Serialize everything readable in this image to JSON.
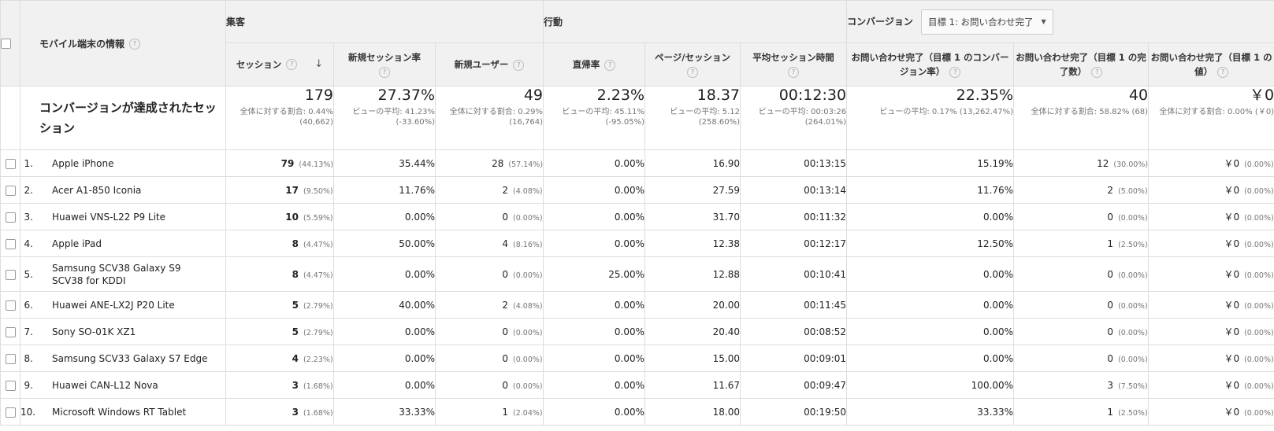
{
  "header": {
    "dimension_label": "モバイル端末の情報",
    "group_acquisition": "集客",
    "group_behavior": "行動",
    "group_conversion": "コンバージョン",
    "goal_select": "目標 1: お問い合わせ完了",
    "columns": {
      "sessions": "セッション",
      "new_session_rate": "新規セッション率",
      "new_users": "新規ユーザー",
      "bounce_rate": "直帰率",
      "pages_per_session": "ページ/セッション",
      "avg_session_duration": "平均セッション時間",
      "goal_cv_rate": "お問い合わせ完了（目標 1 のコンバージョン率）",
      "goal_completions": "お問い合わせ完了（目標 1 の完了数）",
      "goal_value": "お問い合わせ完了（目標 1 の値）"
    },
    "help_glyph": "?",
    "sort_glyph": "↓"
  },
  "totals": {
    "label": "コンバージョンが達成されたセッション",
    "sessions": {
      "value": "179",
      "sub": "全体に対する割合: 0.44% (40,662)"
    },
    "new_session_rate": {
      "value": "27.37%",
      "sub": "ビューの平均: 41.23% (-33.60%)"
    },
    "new_users": {
      "value": "49",
      "sub": "全体に対する割合: 0.29% (16,764)"
    },
    "bounce_rate": {
      "value": "2.23%",
      "sub": "ビューの平均: 45.11% (-95.05%)"
    },
    "pages_per_session": {
      "value": "18.37",
      "sub": "ビューの平均: 5.12 (258.60%)"
    },
    "avg_session_duration": {
      "value": "00:12:30",
      "sub": "ビューの平均: 00:03:26 (264.01%)"
    },
    "goal_cv_rate": {
      "value": "22.35%",
      "sub": "ビューの平均: 0.17% (13,262.47%)"
    },
    "goal_completions": {
      "value": "40",
      "sub": "全体に対する割合: 58.82% (68)"
    },
    "goal_value": {
      "value": "￥0",
      "sub": "全体に対する割合: 0.00% (￥0)"
    }
  },
  "rows": [
    {
      "index": "1.",
      "device": "Apple iPhone",
      "sessions": "79",
      "sessions_pct": "(44.13%)",
      "new_session_rate": "35.44%",
      "new_users": "28",
      "new_users_pct": "(57.14%)",
      "bounce_rate": "0.00%",
      "pages_per_session": "16.90",
      "avg_session_duration": "00:13:15",
      "goal_cv_rate": "15.19%",
      "goal_completions": "12",
      "goal_completions_pct": "(30.00%)",
      "goal_value": "￥0",
      "goal_value_pct": "(0.00%)"
    },
    {
      "index": "2.",
      "device": "Acer A1-850 Iconia",
      "sessions": "17",
      "sessions_pct": "(9.50%)",
      "new_session_rate": "11.76%",
      "new_users": "2",
      "new_users_pct": "(4.08%)",
      "bounce_rate": "0.00%",
      "pages_per_session": "27.59",
      "avg_session_duration": "00:13:14",
      "goal_cv_rate": "11.76%",
      "goal_completions": "2",
      "goal_completions_pct": "(5.00%)",
      "goal_value": "￥0",
      "goal_value_pct": "(0.00%)"
    },
    {
      "index": "3.",
      "device": "Huawei VNS-L22 P9 Lite",
      "sessions": "10",
      "sessions_pct": "(5.59%)",
      "new_session_rate": "0.00%",
      "new_users": "0",
      "new_users_pct": "(0.00%)",
      "bounce_rate": "0.00%",
      "pages_per_session": "31.70",
      "avg_session_duration": "00:11:32",
      "goal_cv_rate": "0.00%",
      "goal_completions": "0",
      "goal_completions_pct": "(0.00%)",
      "goal_value": "￥0",
      "goal_value_pct": "(0.00%)"
    },
    {
      "index": "4.",
      "device": "Apple iPad",
      "sessions": "8",
      "sessions_pct": "(4.47%)",
      "new_session_rate": "50.00%",
      "new_users": "4",
      "new_users_pct": "(8.16%)",
      "bounce_rate": "0.00%",
      "pages_per_session": "12.38",
      "avg_session_duration": "00:12:17",
      "goal_cv_rate": "12.50%",
      "goal_completions": "1",
      "goal_completions_pct": "(2.50%)",
      "goal_value": "￥0",
      "goal_value_pct": "(0.00%)"
    },
    {
      "index": "5.",
      "device": "Samsung SCV38 Galaxy S9 SCV38 for KDDI",
      "sessions": "8",
      "sessions_pct": "(4.47%)",
      "new_session_rate": "0.00%",
      "new_users": "0",
      "new_users_pct": "(0.00%)",
      "bounce_rate": "25.00%",
      "pages_per_session": "12.88",
      "avg_session_duration": "00:10:41",
      "goal_cv_rate": "0.00%",
      "goal_completions": "0",
      "goal_completions_pct": "(0.00%)",
      "goal_value": "￥0",
      "goal_value_pct": "(0.00%)"
    },
    {
      "index": "6.",
      "device": "Huawei ANE-LX2J P20 Lite",
      "sessions": "5",
      "sessions_pct": "(2.79%)",
      "new_session_rate": "40.00%",
      "new_users": "2",
      "new_users_pct": "(4.08%)",
      "bounce_rate": "0.00%",
      "pages_per_session": "20.00",
      "avg_session_duration": "00:11:45",
      "goal_cv_rate": "0.00%",
      "goal_completions": "0",
      "goal_completions_pct": "(0.00%)",
      "goal_value": "￥0",
      "goal_value_pct": "(0.00%)"
    },
    {
      "index": "7.",
      "device": "Sony SO-01K XZ1",
      "sessions": "5",
      "sessions_pct": "(2.79%)",
      "new_session_rate": "0.00%",
      "new_users": "0",
      "new_users_pct": "(0.00%)",
      "bounce_rate": "0.00%",
      "pages_per_session": "20.40",
      "avg_session_duration": "00:08:52",
      "goal_cv_rate": "0.00%",
      "goal_completions": "0",
      "goal_completions_pct": "(0.00%)",
      "goal_value": "￥0",
      "goal_value_pct": "(0.00%)"
    },
    {
      "index": "8.",
      "device": "Samsung SCV33 Galaxy S7 Edge",
      "sessions": "4",
      "sessions_pct": "(2.23%)",
      "new_session_rate": "0.00%",
      "new_users": "0",
      "new_users_pct": "(0.00%)",
      "bounce_rate": "0.00%",
      "pages_per_session": "15.00",
      "avg_session_duration": "00:09:01",
      "goal_cv_rate": "0.00%",
      "goal_completions": "0",
      "goal_completions_pct": "(0.00%)",
      "goal_value": "￥0",
      "goal_value_pct": "(0.00%)"
    },
    {
      "index": "9.",
      "device": "Huawei CAN-L12 Nova",
      "sessions": "3",
      "sessions_pct": "(1.68%)",
      "new_session_rate": "0.00%",
      "new_users": "0",
      "new_users_pct": "(0.00%)",
      "bounce_rate": "0.00%",
      "pages_per_session": "11.67",
      "avg_session_duration": "00:09:47",
      "goal_cv_rate": "100.00%",
      "goal_completions": "3",
      "goal_completions_pct": "(7.50%)",
      "goal_value": "￥0",
      "goal_value_pct": "(0.00%)"
    },
    {
      "index": "10.",
      "device": "Microsoft Windows RT Tablet",
      "sessions": "3",
      "sessions_pct": "(1.68%)",
      "new_session_rate": "33.33%",
      "new_users": "1",
      "new_users_pct": "(2.04%)",
      "bounce_rate": "0.00%",
      "pages_per_session": "18.00",
      "avg_session_duration": "00:19:50",
      "goal_cv_rate": "33.33%",
      "goal_completions": "1",
      "goal_completions_pct": "(2.50%)",
      "goal_value": "￥0",
      "goal_value_pct": "(0.00%)"
    }
  ]
}
